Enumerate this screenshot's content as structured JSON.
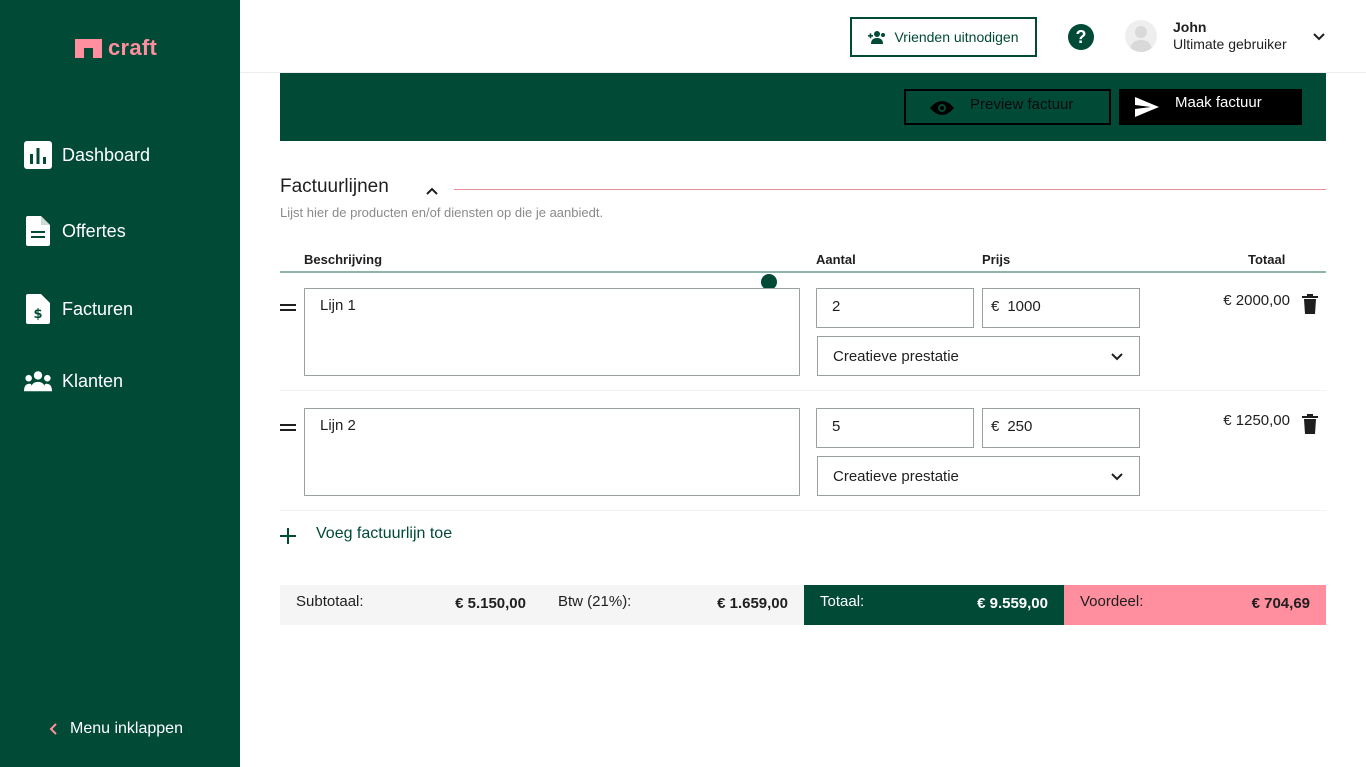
{
  "brand": {
    "name": "craft",
    "color": "#ff8e9e",
    "sidebar_bg": "#014a36"
  },
  "sidebar": {
    "items": [
      {
        "label": "Dashboard",
        "icon": "bar-chart-icon"
      },
      {
        "label": "Offertes",
        "icon": "document-icon"
      },
      {
        "label": "Facturen",
        "icon": "invoice-dollar-icon"
      },
      {
        "label": "Klanten",
        "icon": "users-icon"
      }
    ],
    "collapse_label": "Menu inklappen"
  },
  "header": {
    "invite_label": "Vrienden uitnodigen",
    "user": {
      "name": "John",
      "role": "Ultimate gebruiker"
    }
  },
  "actions": {
    "preview_label": "Preview factuur",
    "create_label": "Maak factuur"
  },
  "section": {
    "title": "Factuurlijnen",
    "subtitle": "Lijst hier de producten en/of diensten op die je aanbiedt."
  },
  "table": {
    "headers": {
      "description": "Beschrijving",
      "quantity": "Aantal",
      "price": "Prijs",
      "total": "Totaal"
    },
    "rows": [
      {
        "description": "Lijn 1",
        "quantity": "2",
        "currency": "€",
        "price": "1000",
        "category": "Creatieve prestatie",
        "total": "€ 2000,00"
      },
      {
        "description": "Lijn 2",
        "quantity": "5",
        "currency": "€",
        "price": "250",
        "category": "Creatieve prestatie",
        "total": "€ 1250,00"
      }
    ],
    "add_label": "Voeg factuurlijn toe"
  },
  "totals": {
    "subtotal_label": "Subtotaal:",
    "subtotal_value": "€ 5.150,00",
    "vat_label": "Btw (21%):",
    "vat_value": "€ 1.659,00",
    "total_label": "Totaal:",
    "total_value": "€ 9.559,00",
    "benefit_label": "Voordeel:",
    "benefit_value": "€ 704,69"
  }
}
